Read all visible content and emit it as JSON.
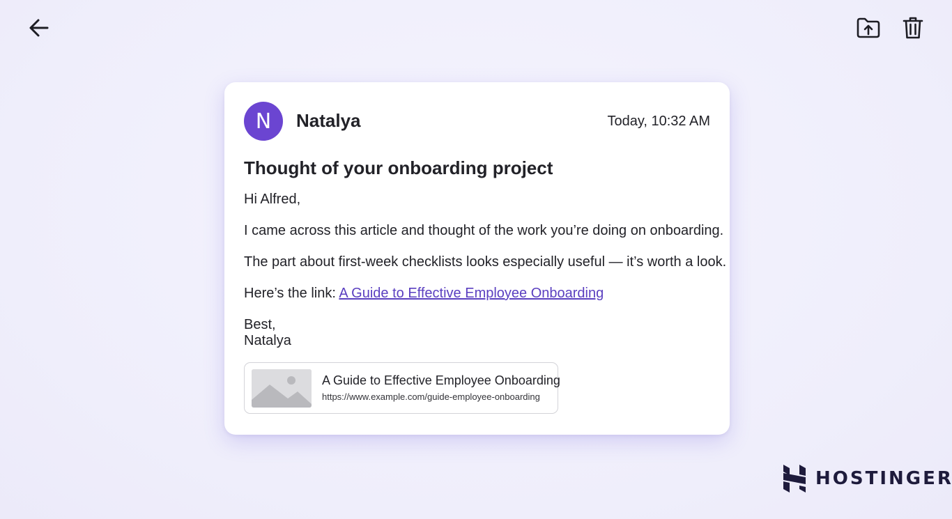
{
  "toolbar": {
    "back_icon": "arrow-left-icon",
    "move_icon": "folder-upload-icon",
    "delete_icon": "trash-icon"
  },
  "email": {
    "sender_initial": "N",
    "sender_name": "Natalya",
    "timestamp": "Today, 10:32 AM",
    "subject": "Thought of your onboarding project",
    "greeting": "Hi Alfred,",
    "paragraph1": "I came across this article and thought of the work you’re doing on onboarding.",
    "paragraph2": "The part about first-week checklists looks especially useful — it’s worth a look.",
    "link_prefix": "Here’s the link: ",
    "link_text": "A Guide to Effective Employee Onboarding",
    "signoff": "Best,",
    "signature": "Natalya"
  },
  "link_preview": {
    "thumbnail_icon": "image-placeholder-icon",
    "title": "A Guide to Effective Employee Onboarding",
    "url": "https://www.example.com/guide-employee-onboarding"
  },
  "branding": {
    "logo_icon": "hostinger-logo-icon",
    "name": "HOSTINGER"
  },
  "colors": {
    "accent": "#6b45d1",
    "link": "#5a3fc0",
    "background": "#f3f2fd",
    "brand": "#1e1b3c"
  }
}
